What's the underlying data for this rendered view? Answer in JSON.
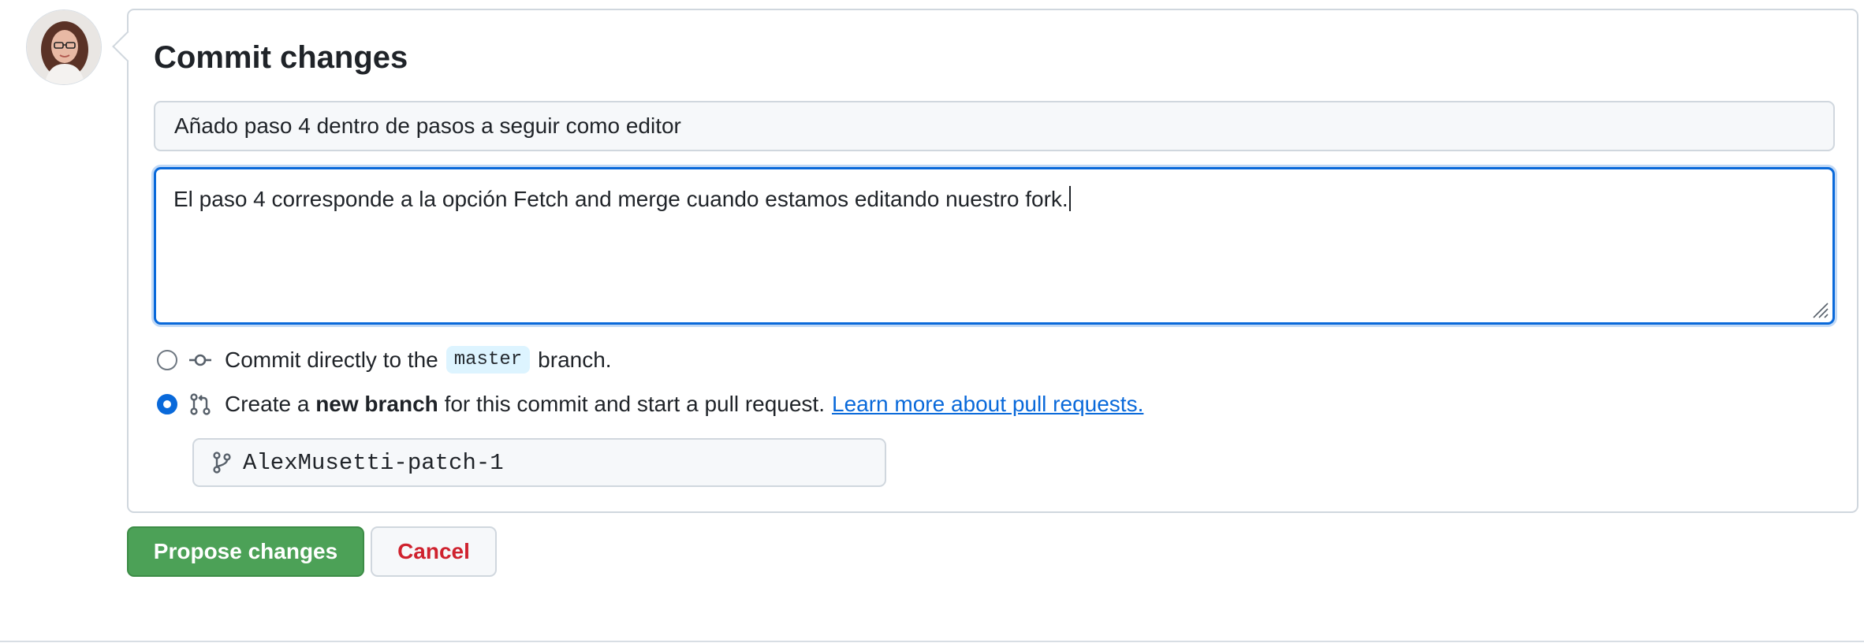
{
  "avatar": {
    "alt": "User avatar"
  },
  "commit_form": {
    "title": "Commit changes",
    "summary_value": "Añado paso 4 dentro de pasos a seguir como editor",
    "description_value": "El paso 4 corresponde a la opción Fetch and merge cuando estamos editando nuestro fork.",
    "options": {
      "direct": {
        "text_before": "Commit directly to the",
        "branch_name": "master",
        "text_after": "branch.",
        "selected": false,
        "icon": "git-commit-icon"
      },
      "new_branch": {
        "text_before": "Create a",
        "bold_text": "new branch",
        "text_after": "for this commit and start a pull request.",
        "link_text": "Learn more about pull requests.",
        "selected": true,
        "icon": "git-pull-request-icon"
      }
    },
    "branch_name_value": "AlexMusetti-patch-1"
  },
  "actions": {
    "propose_label": "Propose changes",
    "cancel_label": "Cancel"
  },
  "colors": {
    "accent": "#0969da",
    "primary_button": "#4ca157",
    "danger_text": "#cf222e",
    "border": "#d0d7de"
  }
}
